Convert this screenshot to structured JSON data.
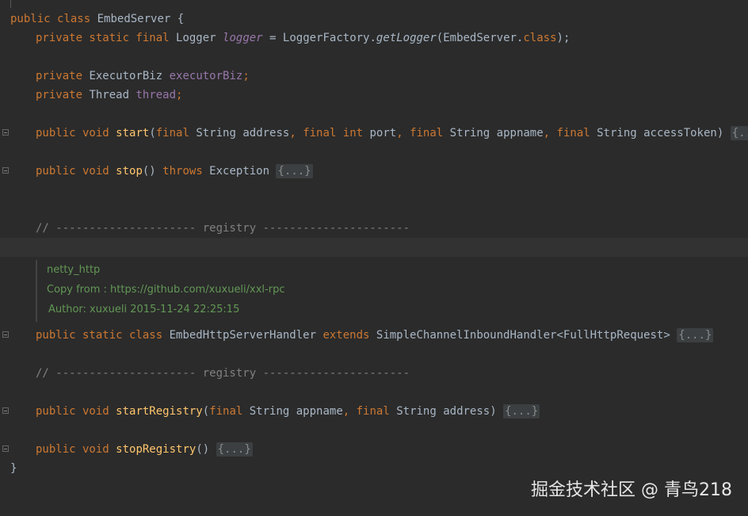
{
  "code": {
    "class_decl": {
      "kw1": "public",
      "kw2": "class",
      "name": "EmbedServer",
      "brace": " {"
    },
    "logger_line": {
      "kw": "private static final",
      "type": "Logger",
      "field": "logger",
      "eq": " = ",
      "call_obj": "LoggerFactory.",
      "call": "getLogger",
      "arg": "(EmbedServer.",
      "arg_kw": "class",
      "end": ");"
    },
    "executor_line": {
      "kw": "private",
      "type": "ExecutorBiz",
      "field": "executorBiz",
      "end": ";"
    },
    "thread_line": {
      "kw": "private",
      "type": "Thread",
      "field": "thread",
      "end": ";"
    },
    "start_line": {
      "kw": "public void",
      "name": "start",
      "open": "(",
      "p1_kw": "final",
      "p1": " String address",
      "sep1": ", ",
      "p2_kw": "final int",
      "p2": " port",
      "sep2": ", ",
      "p3_kw": "final",
      "p3": " String appname",
      "sep3": ", ",
      "p4_kw": "final",
      "p4": " String accessToken",
      "close": ") ",
      "folded": "{...}"
    },
    "stop_line": {
      "kw": "public void",
      "name": "stop",
      "parens": "() ",
      "throws": "throws",
      "exc": " Exception ",
      "folded": "{...}"
    },
    "comment1": "// --------------------- registry ----------------------",
    "doc": {
      "line1": "netty_http",
      "line2": "Copy from : https://github.com/xuxueli/xxl-rpc",
      "line3": "Author: xuxueli 2015-11-24 22:25:15"
    },
    "handler_line": {
      "kw": "public static class",
      "name": " EmbedHttpServerHandler ",
      "ext": "extends",
      "parent": " SimpleChannelInboundHandler<FullHttpRequest> ",
      "folded": "{...}"
    },
    "comment2": "// --------------------- registry ----------------------",
    "start_registry_line": {
      "kw": "public void",
      "name": "startRegistry",
      "open": "(",
      "p1_kw": "final",
      "p1": " String appname",
      "sep1": ", ",
      "p2_kw": "final",
      "p2": " String address",
      "close": ") ",
      "folded": "{...}"
    },
    "stop_registry_line": {
      "kw": "public void",
      "name": "stopRegistry",
      "parens": "() ",
      "folded": "{...}"
    },
    "closing_brace": "}"
  },
  "watermark": "掘金技术社区 @ 青鸟218"
}
